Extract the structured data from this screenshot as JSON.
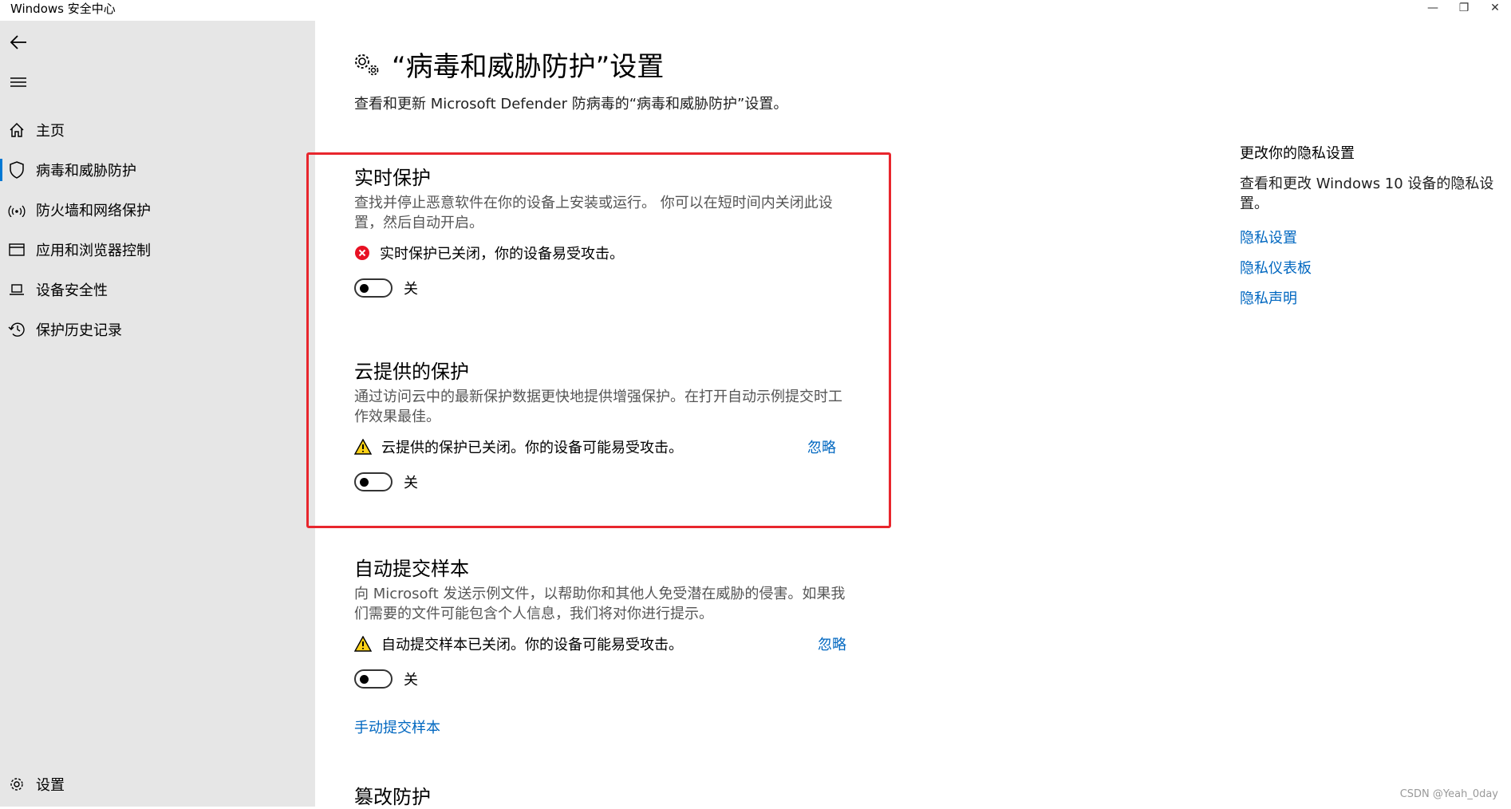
{
  "window": {
    "title": "Windows 安全中心",
    "minimize": "—",
    "restore": "❐",
    "close": "✕"
  },
  "sidebar": {
    "items": [
      {
        "label": "主页",
        "icon": "home-icon"
      },
      {
        "label": "病毒和威胁防护",
        "icon": "shield-icon",
        "active": true
      },
      {
        "label": "防火墙和网络保护",
        "icon": "wifi-icon"
      },
      {
        "label": "应用和浏览器控制",
        "icon": "browser-icon"
      },
      {
        "label": "设备安全性",
        "icon": "laptop-icon"
      },
      {
        "label": "保护历史记录",
        "icon": "history-icon"
      }
    ],
    "settings_label": "设置"
  },
  "page": {
    "title": "“病毒和威胁防护”设置",
    "subtitle": "查看和更新 Microsoft Defender 防病毒的“病毒和威胁防护”设置。"
  },
  "sections": {
    "realtime": {
      "title": "实时保护",
      "desc": "查找并停止恶意软件在你的设备上安装或运行。 你可以在短时间内关闭此设置，然后自动开启。",
      "status": "实时保护已关闭，你的设备易受攻击。",
      "toggle_label": "关"
    },
    "cloud": {
      "title": "云提供的保护",
      "desc": "通过访问云中的最新保护数据更快地提供增强保护。在打开自动示例提交时工作效果最佳。",
      "status": "云提供的保护已关闭。你的设备可能易受攻击。",
      "ignore": "忽略",
      "toggle_label": "关"
    },
    "autosubmit": {
      "title": "自动提交样本",
      "desc": "向 Microsoft 发送示例文件，以帮助你和其他人免受潜在威胁的侵害。如果我们需要的文件可能包含个人信息，我们将对你进行提示。",
      "status": "自动提交样本已关闭。你的设备可能易受攻击。",
      "ignore": "忽略",
      "toggle_label": "关",
      "manual_link": "手动提交样本"
    },
    "tamper": {
      "title": "篡改防护"
    }
  },
  "right_panel": {
    "title": "更改你的隐私设置",
    "desc": "查看和更改 Windows 10 设备的隐私设置。",
    "links": [
      "隐私设置",
      "隐私仪表板",
      "隐私声明"
    ]
  },
  "watermark": "CSDN @Yeah_0day",
  "colors": {
    "accent": "#0067c0",
    "error": "#e81123",
    "warning": "#fcd116",
    "highlight": "#e8262d",
    "sidebar_bg": "#e6e6e6"
  }
}
